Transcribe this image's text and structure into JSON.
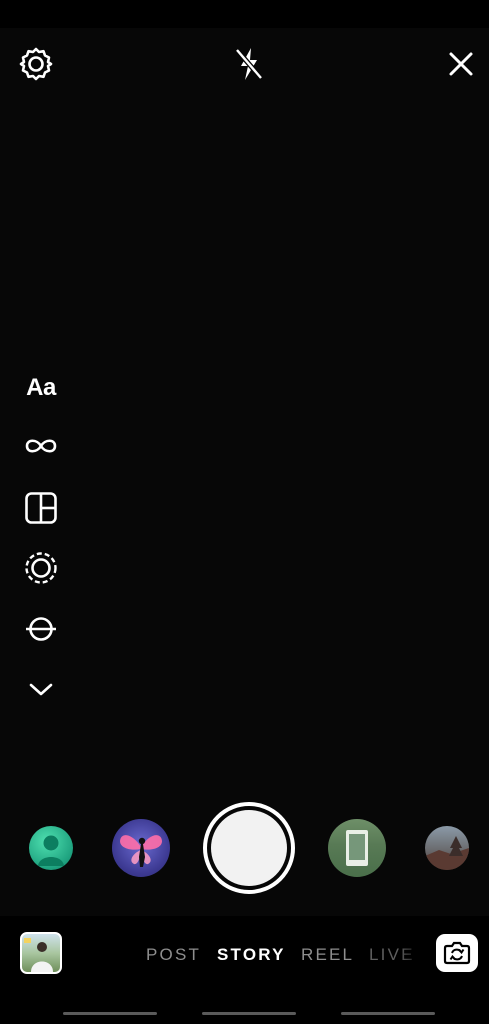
{
  "top_bar": {
    "settings_icon": "gear-icon",
    "flash_icon": "flash-off-icon",
    "close_icon": "close-icon"
  },
  "tools": {
    "text_label": "Aa",
    "items": [
      "create-mode",
      "boomerang",
      "layout",
      "multi-capture",
      "level",
      "more"
    ]
  },
  "effects": [
    "effect-avatar",
    "effect-fairy",
    "effect-frame",
    "effect-landscape"
  ],
  "modes": [
    {
      "label": "POST",
      "active": false
    },
    {
      "label": "STORY",
      "active": true
    },
    {
      "label": "REEL",
      "active": false
    },
    {
      "label": "LIVE",
      "active": false
    }
  ],
  "colors": {
    "background": "#000000",
    "icon": "#ffffff",
    "inactive_mode": "#8e8e8e"
  }
}
